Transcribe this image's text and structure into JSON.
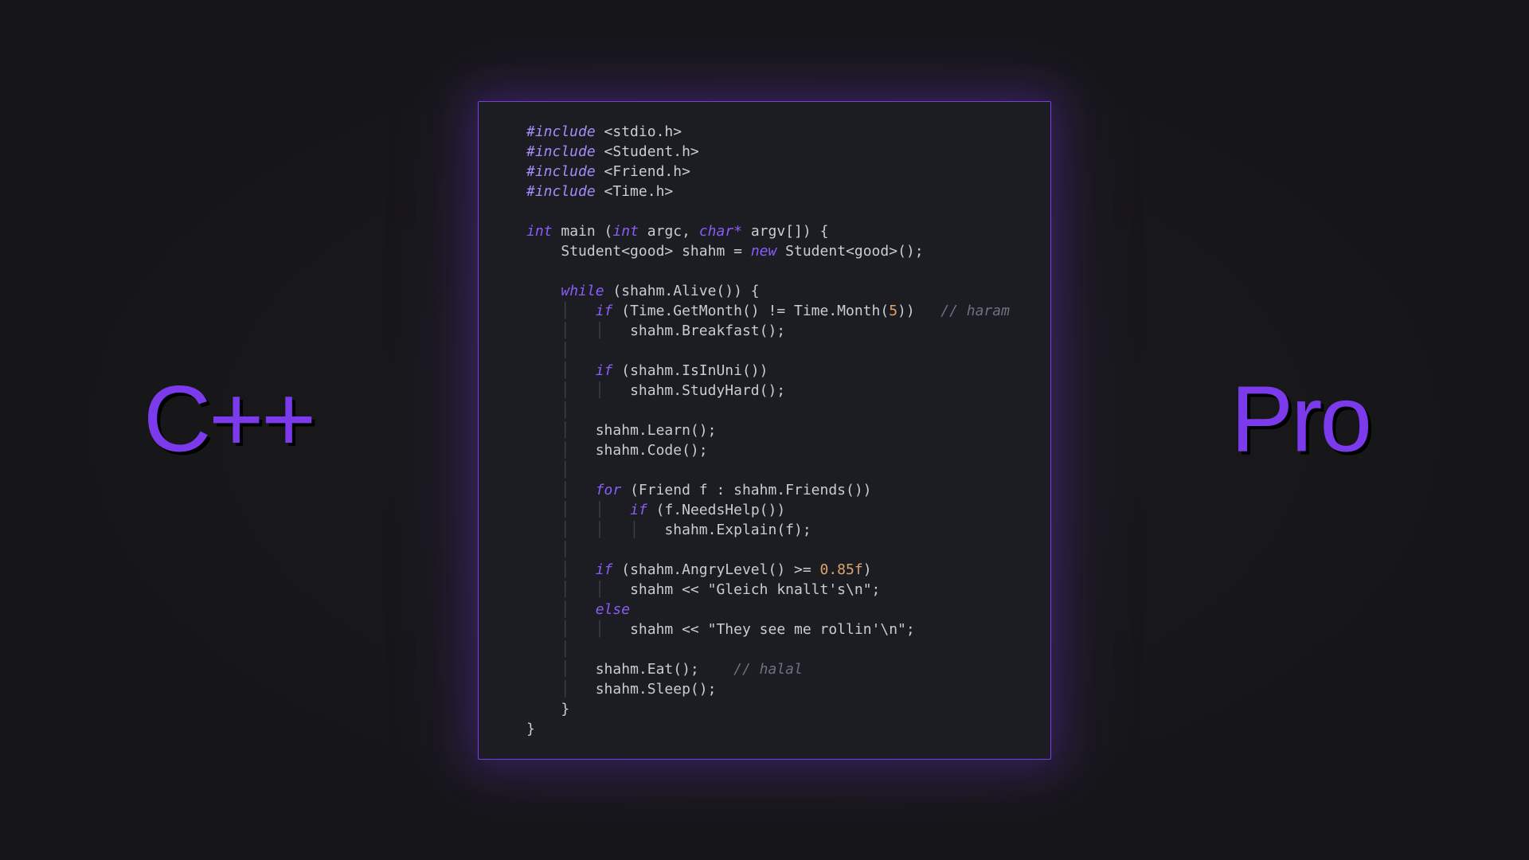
{
  "labels": {
    "left": "C++",
    "right": "Pro"
  },
  "code": {
    "includes": [
      {
        "directive": "#include",
        "header": "<stdio.h>"
      },
      {
        "directive": "#include",
        "header": "<Student.h>"
      },
      {
        "directive": "#include",
        "header": "<Friend.h>"
      },
      {
        "directive": "#include",
        "header": "<Time.h>"
      }
    ],
    "main_sig": {
      "ret": "int",
      "name": "main",
      "p1_type": "int",
      "p1_name": "argc",
      "p2_type": "char*",
      "p2_name": "argv[]"
    },
    "student_line": {
      "type1": "Student",
      "tparam1": "<good>",
      "var": "shahm",
      "eq": "=",
      "newkw": "new",
      "type2": "Student",
      "tparam2": "<good>",
      "tail": "();"
    },
    "while_kw": "while",
    "while_cond": "(shahm.Alive()) {",
    "if1_kw": "if",
    "if1_cond_a": "(Time.GetMonth() != Time.Month(",
    "if1_num": "5",
    "if1_cond_b": "))",
    "if1_cmt": "// haram",
    "if1_body": "shahm.Breakfast();",
    "if2_kw": "if",
    "if2_cond": "(shahm.IsInUni())",
    "if2_body": "shahm.StudyHard();",
    "learn": "shahm.Learn();",
    "code_call": "shahm.Code();",
    "for_kw": "for",
    "for_cond": "(Friend f : shahm.Friends())",
    "for_if_kw": "if",
    "for_if_cond": "(f.NeedsHelp())",
    "for_body": "shahm.Explain(f);",
    "if3_kw": "if",
    "if3_cond_a": "(shahm.AngryLevel() >= ",
    "if3_num": "0.85f",
    "if3_cond_b": ")",
    "if3_body_a": "shahm << ",
    "if3_str": "\"Gleich knallt's\\n\"",
    "if3_body_b": ";",
    "else_kw": "else",
    "else_body_a": "shahm << ",
    "else_str": "\"They see me rollin'\\n\"",
    "else_body_b": ";",
    "eat": "shahm.Eat();",
    "eat_cmt": "// halal",
    "sleep": "shahm.Sleep();",
    "close1": "}",
    "close2": "}",
    "open_brace": "{"
  }
}
